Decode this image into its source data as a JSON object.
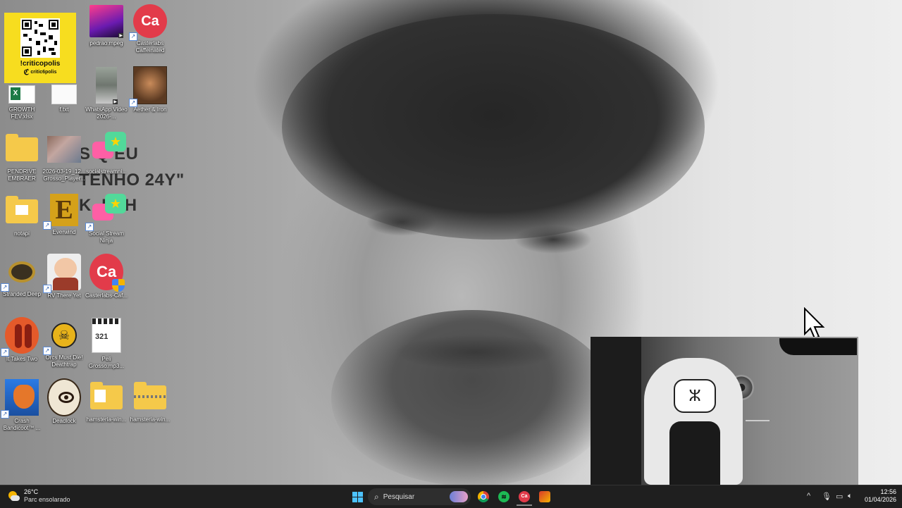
{
  "overlay_text": [
    "S Q EU",
    "TENHO 24Y\"",
    "K, PAH"
  ],
  "qr_card": {
    "title": "!criticopolis",
    "brand": "critic6polis"
  },
  "icons": [
    {
      "label": "pedrao.mpeg",
      "icon": "video-thumbnail-icon"
    },
    {
      "label": "Casterlabs Caffeinated",
      "icon": "casterlabs-icon"
    },
    {
      "label": "GROWTH FEV.xlsx",
      "icon": "excel-file-icon"
    },
    {
      "label": "f.txt",
      "icon": "text-file-icon"
    },
    {
      "label": "WhatsApp Video 2026-...",
      "icon": "video-thumbnail-icon"
    },
    {
      "label": "Aether & Iron",
      "icon": "game-icon"
    },
    {
      "label": "PENDRIVE EMBRAER",
      "icon": "folder-icon"
    },
    {
      "label": "2026-03-19_12... Grosso_Player...",
      "icon": "image-thumbnail-icon"
    },
    {
      "label": "socialstreamni...",
      "icon": "social-stream-icon"
    },
    {
      "label": "notapi",
      "icon": "folder-icon"
    },
    {
      "label": "Everwind",
      "icon": "everwind-icon"
    },
    {
      "label": "Social Stream Ninja",
      "icon": "social-stream-icon"
    },
    {
      "label": "Stranded Deep",
      "icon": "game-icon"
    },
    {
      "label": "RV There Yet",
      "icon": "game-icon"
    },
    {
      "label": "Casterlabs-Caf...",
      "icon": "casterlabs-icon"
    },
    {
      "label": "It Takes Two",
      "icon": "game-icon"
    },
    {
      "label": "Orcs Must Die! Deathtrap",
      "icon": "game-icon"
    },
    {
      "label": "Peli Grosso.mp3...",
      "icon": "media-file-icon"
    },
    {
      "label": "Crash Bandicoot™ ...",
      "icon": "game-icon"
    },
    {
      "label": "Deadlock",
      "icon": "deadlock-icon"
    },
    {
      "label": "hamsteria-win...",
      "icon": "folder-icon"
    },
    {
      "label": "hamsteria-win...",
      "icon": "zip-folder-icon"
    }
  ],
  "taskbar": {
    "weather": {
      "temp": "26°C",
      "desc": "Parc ensolarado"
    },
    "search_placeholder": "Pesquisar",
    "time": "12:56",
    "date": "01/04/2026"
  },
  "colors": {
    "taskbar": "#1f1f1f",
    "qr_card": "#f7dd1f",
    "accent": "#0078d4"
  }
}
